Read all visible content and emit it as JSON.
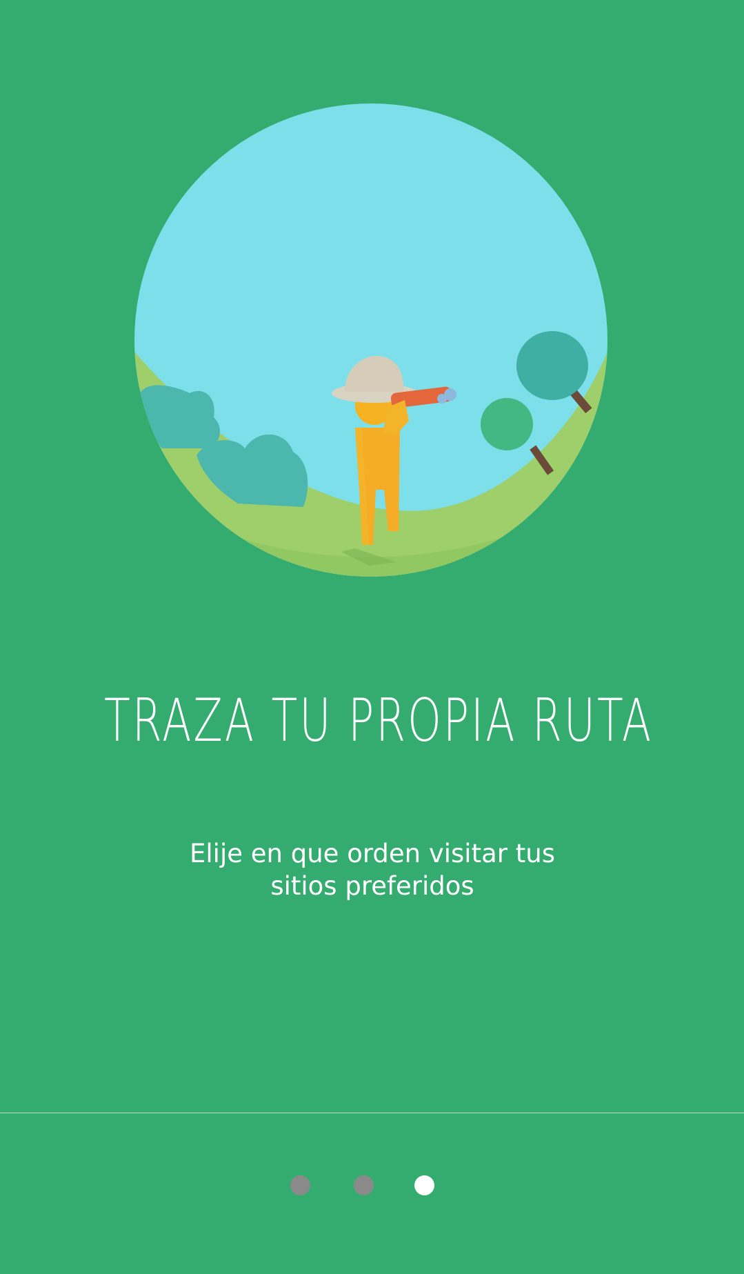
{
  "onboarding": {
    "title": "TRAZA TU PROPIA RUTA",
    "subtitle": "Elije en que orden visitar tus sitios preferidos"
  },
  "illustration": {
    "icon": "explorer-with-binoculars-illustration"
  },
  "pager": {
    "page_count": 3,
    "active_page": 3,
    "active_color": "#ffffff",
    "inactive_color": "#8a8a8a"
  },
  "colors": {
    "background": "#34ac6f",
    "sky": "#7ddfe9",
    "ground": "#9ecf6a"
  }
}
